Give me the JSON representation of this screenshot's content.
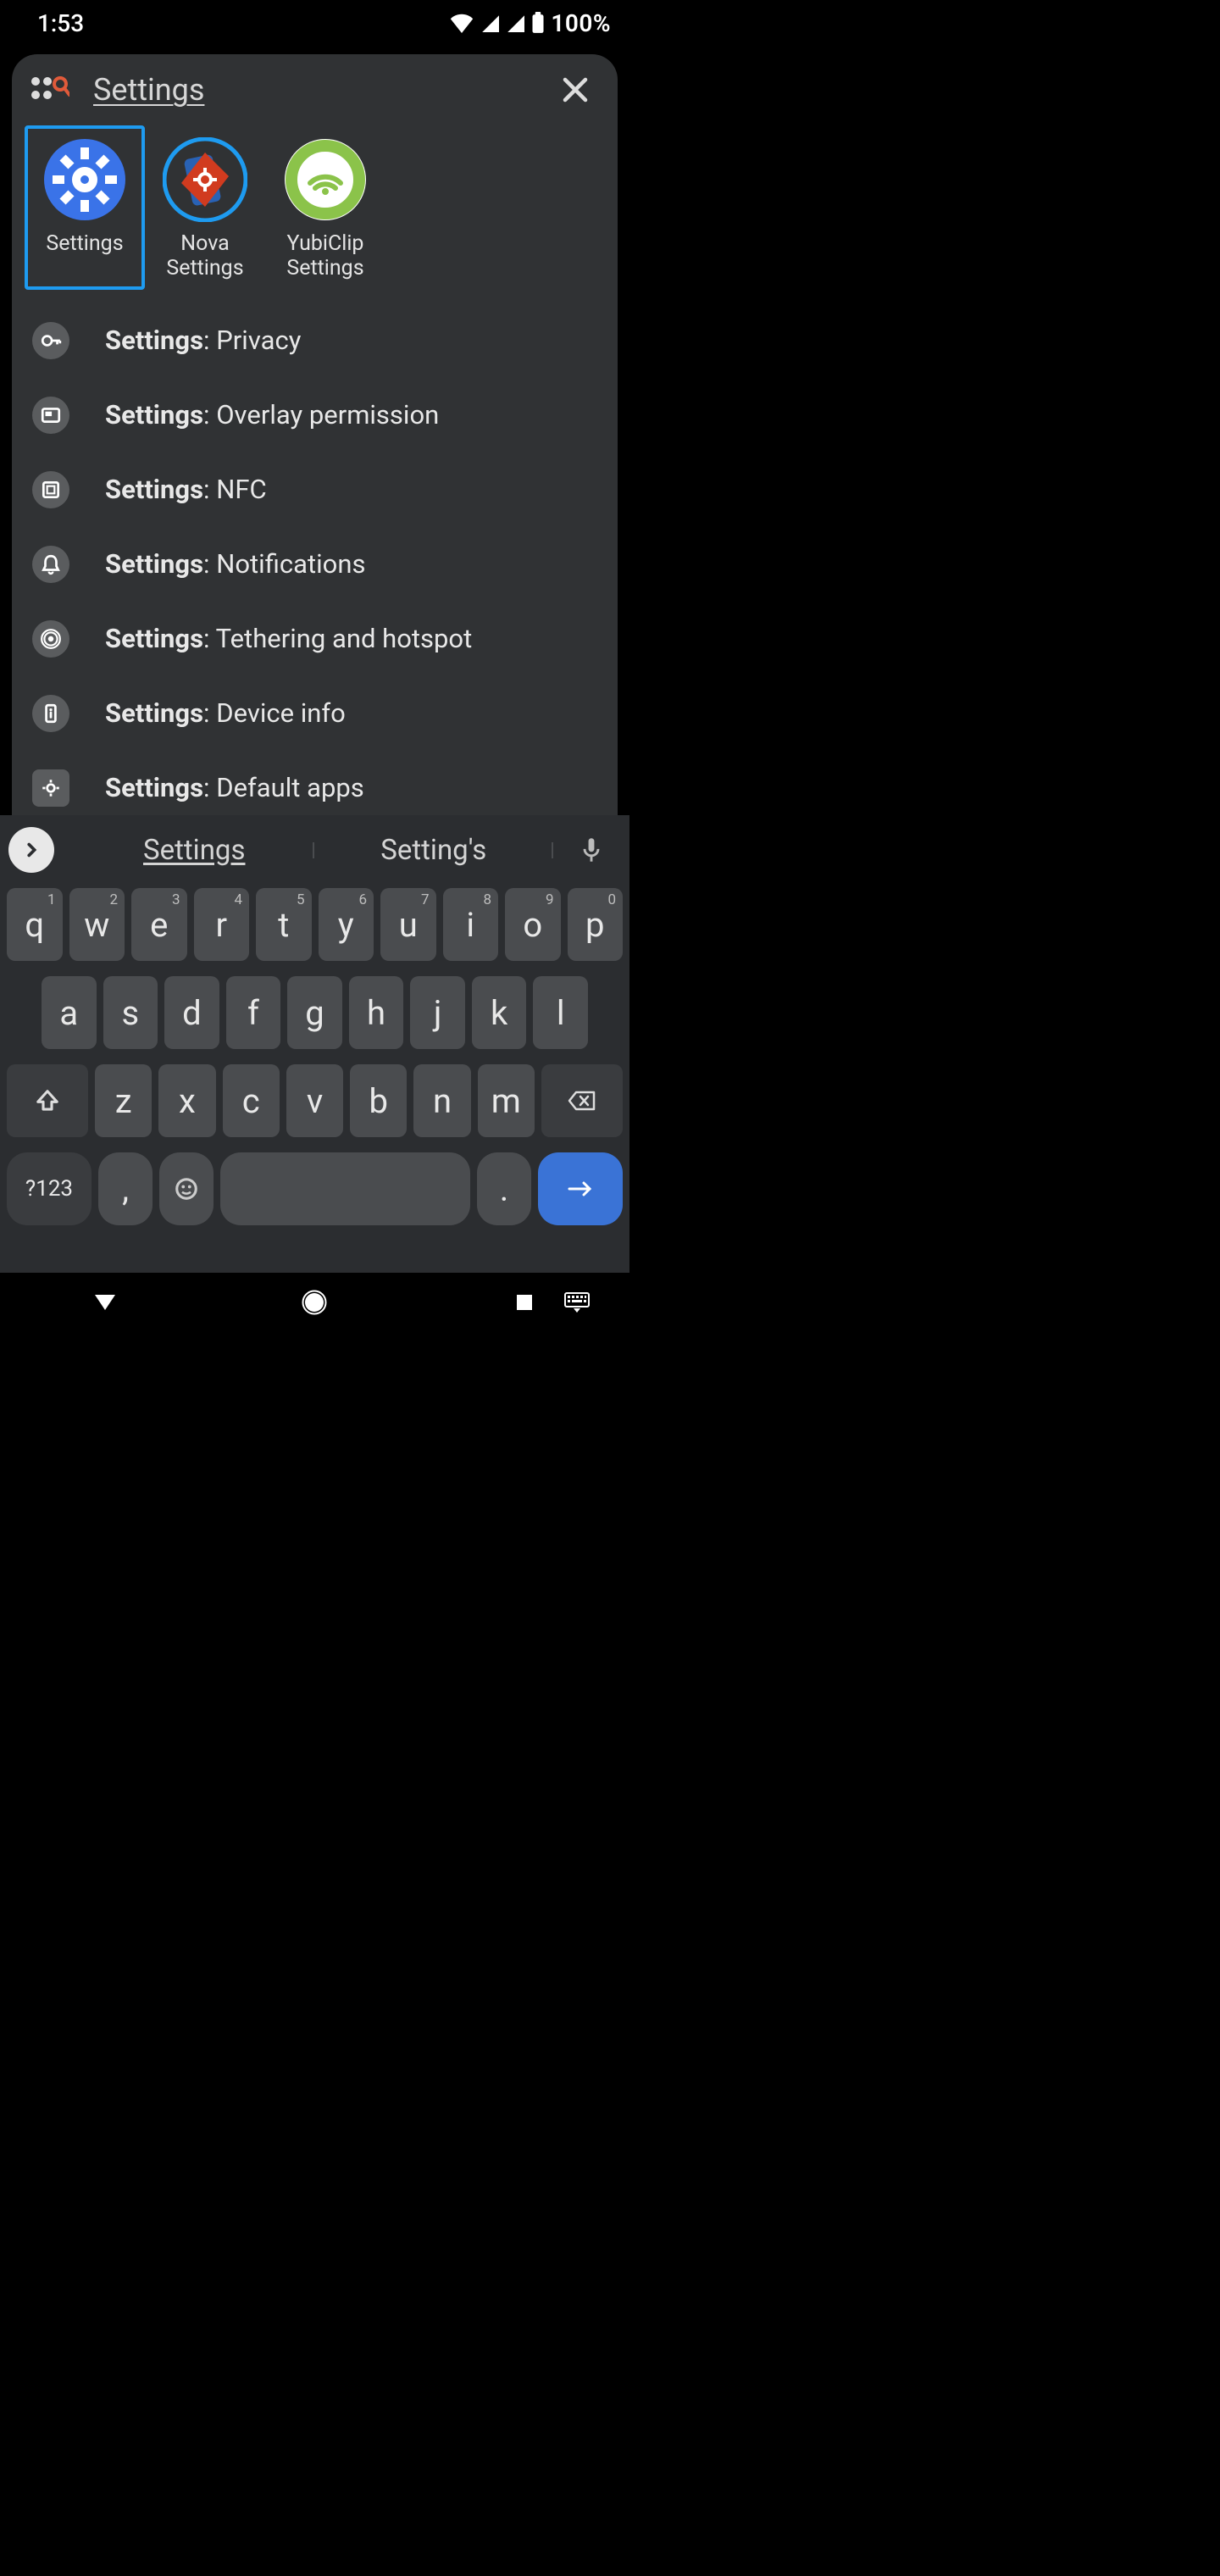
{
  "status": {
    "time": "1:53",
    "battery_pct": "100%"
  },
  "search": {
    "query": "Settings"
  },
  "apps": [
    {
      "label": "Settings",
      "selected": true,
      "icon": "gear-icon"
    },
    {
      "label": "Nova Settings",
      "selected": false,
      "icon": "nova-gear-icon"
    },
    {
      "label": "YubiClip Settings",
      "selected": false,
      "icon": "wifi-ring-icon"
    }
  ],
  "results": [
    {
      "app": "Settings",
      "sub": "Privacy",
      "icon": "key-icon",
      "round": true
    },
    {
      "app": "Settings",
      "sub": "Overlay permission",
      "icon": "pip-icon",
      "round": true
    },
    {
      "app": "Settings",
      "sub": "NFC",
      "icon": "nfc-icon",
      "round": true
    },
    {
      "app": "Settings",
      "sub": "Notifications",
      "icon": "bell-icon",
      "round": true
    },
    {
      "app": "Settings",
      "sub": "Tethering and hotspot",
      "icon": "hotspot-icon",
      "round": true
    },
    {
      "app": "Settings",
      "sub": "Device info",
      "icon": "phone-info-icon",
      "round": true
    },
    {
      "app": "Settings",
      "sub": "Default apps",
      "icon": "default-apps-icon",
      "round": false
    }
  ],
  "suggestions": {
    "primary": "Settings",
    "secondary": "Setting's"
  },
  "keyboard": {
    "row1": [
      {
        "k": "q",
        "h": "1"
      },
      {
        "k": "w",
        "h": "2"
      },
      {
        "k": "e",
        "h": "3"
      },
      {
        "k": "r",
        "h": "4"
      },
      {
        "k": "t",
        "h": "5"
      },
      {
        "k": "y",
        "h": "6"
      },
      {
        "k": "u",
        "h": "7"
      },
      {
        "k": "i",
        "h": "8"
      },
      {
        "k": "o",
        "h": "9"
      },
      {
        "k": "p",
        "h": "0"
      }
    ],
    "row2": [
      "a",
      "s",
      "d",
      "f",
      "g",
      "h",
      "j",
      "k",
      "l"
    ],
    "row3": [
      "z",
      "x",
      "c",
      "v",
      "b",
      "n",
      "m"
    ],
    "symkey": "?123",
    "comma": ",",
    "period": "."
  }
}
